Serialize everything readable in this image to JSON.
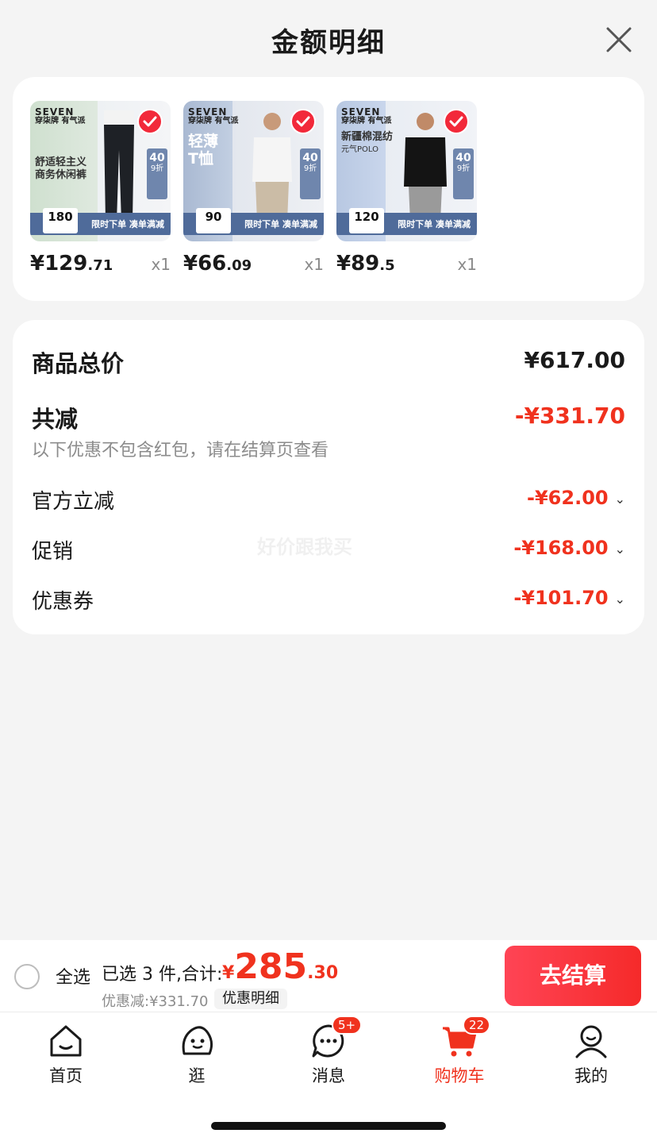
{
  "header": {
    "title": "金额明细"
  },
  "products": [
    {
      "brand": "SEVEN",
      "brand_sub": "穿柒牌 有气派",
      "promo_lines": [
        "舒适轻主义",
        "商务休闲裤"
      ],
      "side_badge": {
        "top": "40",
        "bottom": "9折"
      },
      "banner": "限时下单 凑单满减",
      "tag_value": "180",
      "price_int": "¥129",
      "price_dec": ".71",
      "qty": "x1"
    },
    {
      "brand": "SEVEN",
      "brand_sub": "穿柒牌 有气派",
      "promo_lines": [
        "轻薄",
        "T恤"
      ],
      "side_badge": {
        "top": "40",
        "bottom": "9折"
      },
      "banner": "限时下单 凑单满减",
      "tag_value": "90",
      "price_int": "¥66",
      "price_dec": ".09",
      "qty": "x1"
    },
    {
      "brand": "SEVEN",
      "brand_sub": "穿柒牌 有气派",
      "promo_lines": [
        "新疆棉混纺",
        "元气POLO"
      ],
      "side_badge": {
        "top": "40",
        "bottom": "9折"
      },
      "banner": "限时下单 凑单满减",
      "tag_value": "120",
      "price_int": "¥89",
      "price_dec": ".5",
      "qty": "x1"
    }
  ],
  "summary": {
    "total_label": "商品总价",
    "total_value": "¥617.00",
    "reduce_label": "共减",
    "reduce_value": "-¥331.70",
    "note": "以下优惠不包含红包，请在结算页查看",
    "items": [
      {
        "label": "官方立减",
        "value": "-¥62.00"
      },
      {
        "label": "促销",
        "value": "-¥168.00"
      },
      {
        "label": "优惠券",
        "value": "-¥101.70"
      }
    ],
    "watermark": "好价跟我买"
  },
  "checkout": {
    "select_all": "全选",
    "selected_text": "已选 3 件,合计:",
    "total_currency": "¥",
    "total_int": "285",
    "total_dec": ".30",
    "discount_text": "优惠减:¥331.70",
    "detail_button": "优惠明细",
    "submit_button": "去结算"
  },
  "tabbar": {
    "tabs": [
      {
        "label": "首页",
        "icon": "home-icon"
      },
      {
        "label": "逛",
        "icon": "browse-icon"
      },
      {
        "label": "消息",
        "icon": "message-icon",
        "badge": "5+"
      },
      {
        "label": "购物车",
        "icon": "cart-icon",
        "badge": "22",
        "active": true
      },
      {
        "label": "我的",
        "icon": "profile-icon"
      }
    ]
  },
  "colors": {
    "accent": "#f0321e",
    "button": "#f52a2a",
    "background": "#f4f4f4"
  }
}
